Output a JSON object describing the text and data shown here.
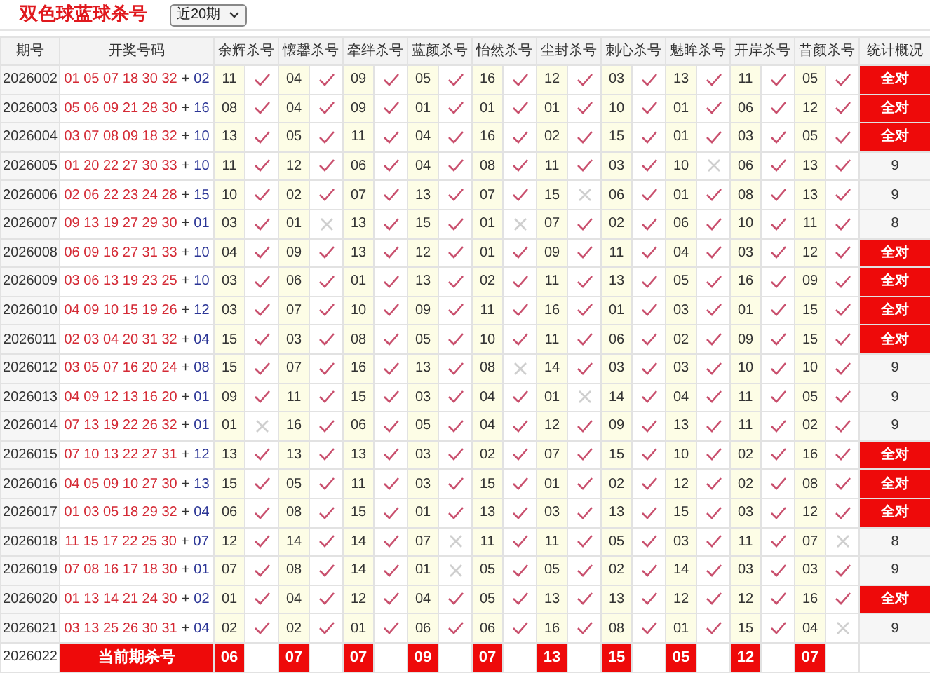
{
  "title": "双色球蓝球杀号",
  "period_select": {
    "value": "近20期"
  },
  "table": {
    "columns": [
      "期号",
      "开奖号码",
      "余辉杀号",
      "懐馨杀号",
      "牵绊杀号",
      "蓝颜杀号",
      "怡然杀号",
      "尘封杀号",
      "刺心杀号",
      "魅眸杀号",
      "开岸杀号",
      "昔颜杀号",
      "统计概况"
    ],
    "rows": [
      {
        "issue": "2026002",
        "red_balls": "01 05 07 18 30 32",
        "plus": "+",
        "blue_ball": "02",
        "picks": [
          {
            "number": "11",
            "hit": true
          },
          {
            "number": "04",
            "hit": true
          },
          {
            "number": "09",
            "hit": true
          },
          {
            "number": "05",
            "hit": true
          },
          {
            "number": "16",
            "hit": true
          },
          {
            "number": "12",
            "hit": true
          },
          {
            "number": "03",
            "hit": true
          },
          {
            "number": "13",
            "hit": true
          },
          {
            "number": "11",
            "hit": true
          },
          {
            "number": "05",
            "hit": true
          }
        ],
        "summary": {
          "kind": "all_correct",
          "text": "全对"
        }
      },
      {
        "issue": "2026003",
        "red_balls": "05 06 09 21 28 30",
        "plus": "+",
        "blue_ball": "16",
        "picks": [
          {
            "number": "08",
            "hit": true
          },
          {
            "number": "04",
            "hit": true
          },
          {
            "number": "09",
            "hit": true
          },
          {
            "number": "01",
            "hit": true
          },
          {
            "number": "01",
            "hit": true
          },
          {
            "number": "01",
            "hit": true
          },
          {
            "number": "10",
            "hit": true
          },
          {
            "number": "01",
            "hit": true
          },
          {
            "number": "06",
            "hit": true
          },
          {
            "number": "12",
            "hit": true
          }
        ],
        "summary": {
          "kind": "all_correct",
          "text": "全对"
        }
      },
      {
        "issue": "2026004",
        "red_balls": "03 07 08 09 18 32",
        "plus": "+",
        "blue_ball": "10",
        "picks": [
          {
            "number": "13",
            "hit": true
          },
          {
            "number": "05",
            "hit": true
          },
          {
            "number": "11",
            "hit": true
          },
          {
            "number": "04",
            "hit": true
          },
          {
            "number": "16",
            "hit": true
          },
          {
            "number": "02",
            "hit": true
          },
          {
            "number": "15",
            "hit": true
          },
          {
            "number": "01",
            "hit": true
          },
          {
            "number": "03",
            "hit": true
          },
          {
            "number": "05",
            "hit": true
          }
        ],
        "summary": {
          "kind": "all_correct",
          "text": "全对"
        }
      },
      {
        "issue": "2026005",
        "red_balls": "01 20 22 27 30 33",
        "plus": "+",
        "blue_ball": "10",
        "picks": [
          {
            "number": "11",
            "hit": true
          },
          {
            "number": "12",
            "hit": true
          },
          {
            "number": "06",
            "hit": true
          },
          {
            "number": "04",
            "hit": true
          },
          {
            "number": "08",
            "hit": true
          },
          {
            "number": "11",
            "hit": true
          },
          {
            "number": "03",
            "hit": true
          },
          {
            "number": "10",
            "hit": false
          },
          {
            "number": "06",
            "hit": true
          },
          {
            "number": "13",
            "hit": true
          }
        ],
        "summary": {
          "kind": "count",
          "text": "9"
        }
      },
      {
        "issue": "2026006",
        "red_balls": "02 06 22 23 24 28",
        "plus": "+",
        "blue_ball": "15",
        "picks": [
          {
            "number": "10",
            "hit": true
          },
          {
            "number": "02",
            "hit": true
          },
          {
            "number": "07",
            "hit": true
          },
          {
            "number": "13",
            "hit": true
          },
          {
            "number": "07",
            "hit": true
          },
          {
            "number": "15",
            "hit": false
          },
          {
            "number": "06",
            "hit": true
          },
          {
            "number": "01",
            "hit": true
          },
          {
            "number": "08",
            "hit": true
          },
          {
            "number": "13",
            "hit": true
          }
        ],
        "summary": {
          "kind": "count",
          "text": "9"
        }
      },
      {
        "issue": "2026007",
        "red_balls": "09 13 19 27 29 30",
        "plus": "+",
        "blue_ball": "01",
        "picks": [
          {
            "number": "03",
            "hit": true
          },
          {
            "number": "01",
            "hit": false
          },
          {
            "number": "13",
            "hit": true
          },
          {
            "number": "15",
            "hit": true
          },
          {
            "number": "01",
            "hit": false
          },
          {
            "number": "07",
            "hit": true
          },
          {
            "number": "02",
            "hit": true
          },
          {
            "number": "06",
            "hit": true
          },
          {
            "number": "10",
            "hit": true
          },
          {
            "number": "11",
            "hit": true
          }
        ],
        "summary": {
          "kind": "count",
          "text": "8"
        }
      },
      {
        "issue": "2026008",
        "red_balls": "06 09 16 27 31 33",
        "plus": "+",
        "blue_ball": "10",
        "picks": [
          {
            "number": "04",
            "hit": true
          },
          {
            "number": "09",
            "hit": true
          },
          {
            "number": "13",
            "hit": true
          },
          {
            "number": "12",
            "hit": true
          },
          {
            "number": "01",
            "hit": true
          },
          {
            "number": "09",
            "hit": true
          },
          {
            "number": "11",
            "hit": true
          },
          {
            "number": "04",
            "hit": true
          },
          {
            "number": "03",
            "hit": true
          },
          {
            "number": "12",
            "hit": true
          }
        ],
        "summary": {
          "kind": "all_correct",
          "text": "全对"
        }
      },
      {
        "issue": "2026009",
        "red_balls": "03 06 13 19 23 25",
        "plus": "+",
        "blue_ball": "10",
        "picks": [
          {
            "number": "03",
            "hit": true
          },
          {
            "number": "06",
            "hit": true
          },
          {
            "number": "01",
            "hit": true
          },
          {
            "number": "13",
            "hit": true
          },
          {
            "number": "02",
            "hit": true
          },
          {
            "number": "11",
            "hit": true
          },
          {
            "number": "13",
            "hit": true
          },
          {
            "number": "05",
            "hit": true
          },
          {
            "number": "16",
            "hit": true
          },
          {
            "number": "09",
            "hit": true
          }
        ],
        "summary": {
          "kind": "all_correct",
          "text": "全对"
        }
      },
      {
        "issue": "2026010",
        "red_balls": "04 09 10 15 19 26",
        "plus": "+",
        "blue_ball": "12",
        "picks": [
          {
            "number": "03",
            "hit": true
          },
          {
            "number": "07",
            "hit": true
          },
          {
            "number": "10",
            "hit": true
          },
          {
            "number": "09",
            "hit": true
          },
          {
            "number": "11",
            "hit": true
          },
          {
            "number": "16",
            "hit": true
          },
          {
            "number": "01",
            "hit": true
          },
          {
            "number": "03",
            "hit": true
          },
          {
            "number": "01",
            "hit": true
          },
          {
            "number": "15",
            "hit": true
          }
        ],
        "summary": {
          "kind": "all_correct",
          "text": "全对"
        }
      },
      {
        "issue": "2026011",
        "red_balls": "02 03 04 20 31 32",
        "plus": "+",
        "blue_ball": "04",
        "picks": [
          {
            "number": "15",
            "hit": true
          },
          {
            "number": "03",
            "hit": true
          },
          {
            "number": "08",
            "hit": true
          },
          {
            "number": "05",
            "hit": true
          },
          {
            "number": "10",
            "hit": true
          },
          {
            "number": "11",
            "hit": true
          },
          {
            "number": "06",
            "hit": true
          },
          {
            "number": "02",
            "hit": true
          },
          {
            "number": "09",
            "hit": true
          },
          {
            "number": "15",
            "hit": true
          }
        ],
        "summary": {
          "kind": "all_correct",
          "text": "全对"
        }
      },
      {
        "issue": "2026012",
        "red_balls": "03 05 07 16 20 24",
        "plus": "+",
        "blue_ball": "08",
        "picks": [
          {
            "number": "15",
            "hit": true
          },
          {
            "number": "07",
            "hit": true
          },
          {
            "number": "16",
            "hit": true
          },
          {
            "number": "13",
            "hit": true
          },
          {
            "number": "08",
            "hit": false
          },
          {
            "number": "14",
            "hit": true
          },
          {
            "number": "03",
            "hit": true
          },
          {
            "number": "03",
            "hit": true
          },
          {
            "number": "10",
            "hit": true
          },
          {
            "number": "10",
            "hit": true
          }
        ],
        "summary": {
          "kind": "count",
          "text": "9"
        }
      },
      {
        "issue": "2026013",
        "red_balls": "04 09 12 13 16 20",
        "plus": "+",
        "blue_ball": "01",
        "picks": [
          {
            "number": "09",
            "hit": true
          },
          {
            "number": "11",
            "hit": true
          },
          {
            "number": "15",
            "hit": true
          },
          {
            "number": "03",
            "hit": true
          },
          {
            "number": "04",
            "hit": true
          },
          {
            "number": "01",
            "hit": false
          },
          {
            "number": "14",
            "hit": true
          },
          {
            "number": "04",
            "hit": true
          },
          {
            "number": "11",
            "hit": true
          },
          {
            "number": "05",
            "hit": true
          }
        ],
        "summary": {
          "kind": "count",
          "text": "9"
        }
      },
      {
        "issue": "2026014",
        "red_balls": "07 13 19 22 26 32",
        "plus": "+",
        "blue_ball": "01",
        "picks": [
          {
            "number": "01",
            "hit": false
          },
          {
            "number": "16",
            "hit": true
          },
          {
            "number": "06",
            "hit": true
          },
          {
            "number": "05",
            "hit": true
          },
          {
            "number": "04",
            "hit": true
          },
          {
            "number": "12",
            "hit": true
          },
          {
            "number": "09",
            "hit": true
          },
          {
            "number": "13",
            "hit": true
          },
          {
            "number": "11",
            "hit": true
          },
          {
            "number": "02",
            "hit": true
          }
        ],
        "summary": {
          "kind": "count",
          "text": "9"
        }
      },
      {
        "issue": "2026015",
        "red_balls": "07 10 13 22 27 31",
        "plus": "+",
        "blue_ball": "12",
        "picks": [
          {
            "number": "13",
            "hit": true
          },
          {
            "number": "13",
            "hit": true
          },
          {
            "number": "13",
            "hit": true
          },
          {
            "number": "03",
            "hit": true
          },
          {
            "number": "02",
            "hit": true
          },
          {
            "number": "07",
            "hit": true
          },
          {
            "number": "15",
            "hit": true
          },
          {
            "number": "10",
            "hit": true
          },
          {
            "number": "02",
            "hit": true
          },
          {
            "number": "16",
            "hit": true
          }
        ],
        "summary": {
          "kind": "all_correct",
          "text": "全对"
        }
      },
      {
        "issue": "2026016",
        "red_balls": "04 05 09 10 27 30",
        "plus": "+",
        "blue_ball": "13",
        "picks": [
          {
            "number": "15",
            "hit": true
          },
          {
            "number": "05",
            "hit": true
          },
          {
            "number": "11",
            "hit": true
          },
          {
            "number": "03",
            "hit": true
          },
          {
            "number": "15",
            "hit": true
          },
          {
            "number": "01",
            "hit": true
          },
          {
            "number": "02",
            "hit": true
          },
          {
            "number": "12",
            "hit": true
          },
          {
            "number": "02",
            "hit": true
          },
          {
            "number": "08",
            "hit": true
          }
        ],
        "summary": {
          "kind": "all_correct",
          "text": "全对"
        }
      },
      {
        "issue": "2026017",
        "red_balls": "01 03 05 18 29 32",
        "plus": "+",
        "blue_ball": "04",
        "picks": [
          {
            "number": "06",
            "hit": true
          },
          {
            "number": "08",
            "hit": true
          },
          {
            "number": "15",
            "hit": true
          },
          {
            "number": "01",
            "hit": true
          },
          {
            "number": "13",
            "hit": true
          },
          {
            "number": "03",
            "hit": true
          },
          {
            "number": "13",
            "hit": true
          },
          {
            "number": "15",
            "hit": true
          },
          {
            "number": "03",
            "hit": true
          },
          {
            "number": "12",
            "hit": true
          }
        ],
        "summary": {
          "kind": "all_correct",
          "text": "全对"
        }
      },
      {
        "issue": "2026018",
        "red_balls": "11 15 17 22 25 30",
        "plus": "+",
        "blue_ball": "07",
        "picks": [
          {
            "number": "12",
            "hit": true
          },
          {
            "number": "14",
            "hit": true
          },
          {
            "number": "14",
            "hit": true
          },
          {
            "number": "07",
            "hit": false
          },
          {
            "number": "11",
            "hit": true
          },
          {
            "number": "11",
            "hit": true
          },
          {
            "number": "05",
            "hit": true
          },
          {
            "number": "03",
            "hit": true
          },
          {
            "number": "11",
            "hit": true
          },
          {
            "number": "07",
            "hit": false
          }
        ],
        "summary": {
          "kind": "count",
          "text": "8"
        }
      },
      {
        "issue": "2026019",
        "red_balls": "07 08 16 17 18 30",
        "plus": "+",
        "blue_ball": "01",
        "picks": [
          {
            "number": "07",
            "hit": true
          },
          {
            "number": "08",
            "hit": true
          },
          {
            "number": "14",
            "hit": true
          },
          {
            "number": "01",
            "hit": false
          },
          {
            "number": "05",
            "hit": true
          },
          {
            "number": "05",
            "hit": true
          },
          {
            "number": "02",
            "hit": true
          },
          {
            "number": "14",
            "hit": true
          },
          {
            "number": "03",
            "hit": true
          },
          {
            "number": "03",
            "hit": true
          }
        ],
        "summary": {
          "kind": "count",
          "text": "9"
        }
      },
      {
        "issue": "2026020",
        "red_balls": "01 13 14 21 24 30",
        "plus": "+",
        "blue_ball": "02",
        "picks": [
          {
            "number": "01",
            "hit": true
          },
          {
            "number": "04",
            "hit": true
          },
          {
            "number": "12",
            "hit": true
          },
          {
            "number": "04",
            "hit": true
          },
          {
            "number": "05",
            "hit": true
          },
          {
            "number": "13",
            "hit": true
          },
          {
            "number": "13",
            "hit": true
          },
          {
            "number": "12",
            "hit": true
          },
          {
            "number": "12",
            "hit": true
          },
          {
            "number": "16",
            "hit": true
          }
        ],
        "summary": {
          "kind": "all_correct",
          "text": "全对"
        }
      },
      {
        "issue": "2026021",
        "red_balls": "03 13 25 26 30 31",
        "plus": "+",
        "blue_ball": "04",
        "picks": [
          {
            "number": "02",
            "hit": true
          },
          {
            "number": "02",
            "hit": true
          },
          {
            "number": "01",
            "hit": true
          },
          {
            "number": "06",
            "hit": true
          },
          {
            "number": "06",
            "hit": true
          },
          {
            "number": "16",
            "hit": true
          },
          {
            "number": "08",
            "hit": true
          },
          {
            "number": "01",
            "hit": true
          },
          {
            "number": "15",
            "hit": true
          },
          {
            "number": "04",
            "hit": false
          }
        ],
        "summary": {
          "kind": "count",
          "text": "9"
        }
      }
    ],
    "current": {
      "issue": "2026022",
      "label": "当前期杀号",
      "picks": [
        "06",
        "07",
        "07",
        "09",
        "07",
        "13",
        "15",
        "05",
        "12",
        "07"
      ]
    }
  }
}
